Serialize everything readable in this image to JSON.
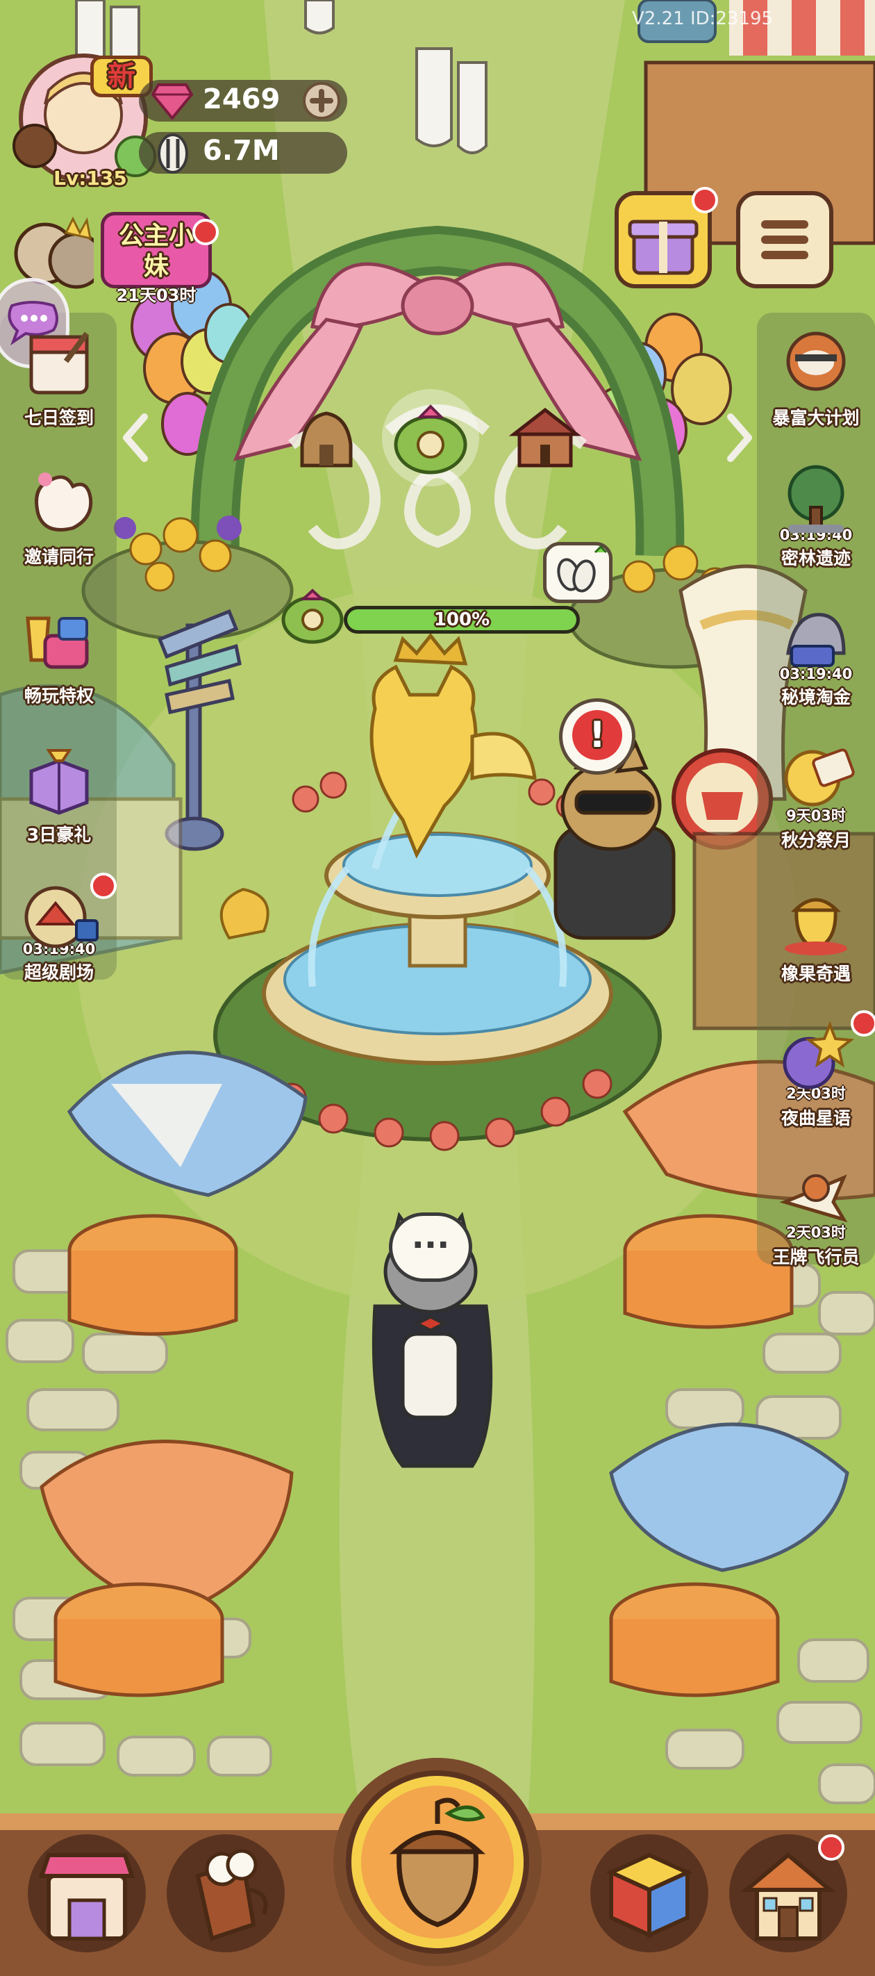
{
  "player": {
    "level": "Lv:135",
    "new_badge": "新"
  },
  "resources": {
    "gems": "2469",
    "seeds": "6.7M"
  },
  "version_text": "V2.21 ID:23195",
  "princess_event": {
    "title": "公主小妹",
    "timer": "21天03时"
  },
  "left_menu": [
    {
      "name": "七日签到"
    },
    {
      "name": "邀请同行"
    },
    {
      "name": "畅玩特权"
    },
    {
      "name": "3日豪礼"
    },
    {
      "name": "超级剧场",
      "timer": "03:19:40"
    }
  ],
  "right_menu": [
    {
      "name": "暴富大计划"
    },
    {
      "name": "密林遗迹",
      "timer": "03:19:40"
    },
    {
      "name": "秘境淘金",
      "timer": "03:19:40"
    },
    {
      "name": "秋分祭月",
      "timer": "9天03时"
    },
    {
      "name": "橡果奇遇"
    },
    {
      "name": "夜曲星语",
      "timer": "2天03时"
    },
    {
      "name": "王牌飞行员",
      "timer": "2天03时"
    }
  ],
  "build_progress": {
    "percent_text": "100%",
    "percent": 1.0
  },
  "speech": "...",
  "alert": "!",
  "colors": {
    "grass": "#a9c95f",
    "path": "#d7d6a6",
    "wood": "#7a4a2c",
    "progress_green": "#7fd34e",
    "red_dot": "#e23b3b"
  },
  "icons": {
    "gift": "gift-icon",
    "menu": "menu-icon",
    "chat": "chat-bubble-icon",
    "shop": "shop-icon",
    "drink": "drink-icon",
    "acorn": "acorn-icon",
    "cube": "cube-icon",
    "house": "house-icon"
  }
}
